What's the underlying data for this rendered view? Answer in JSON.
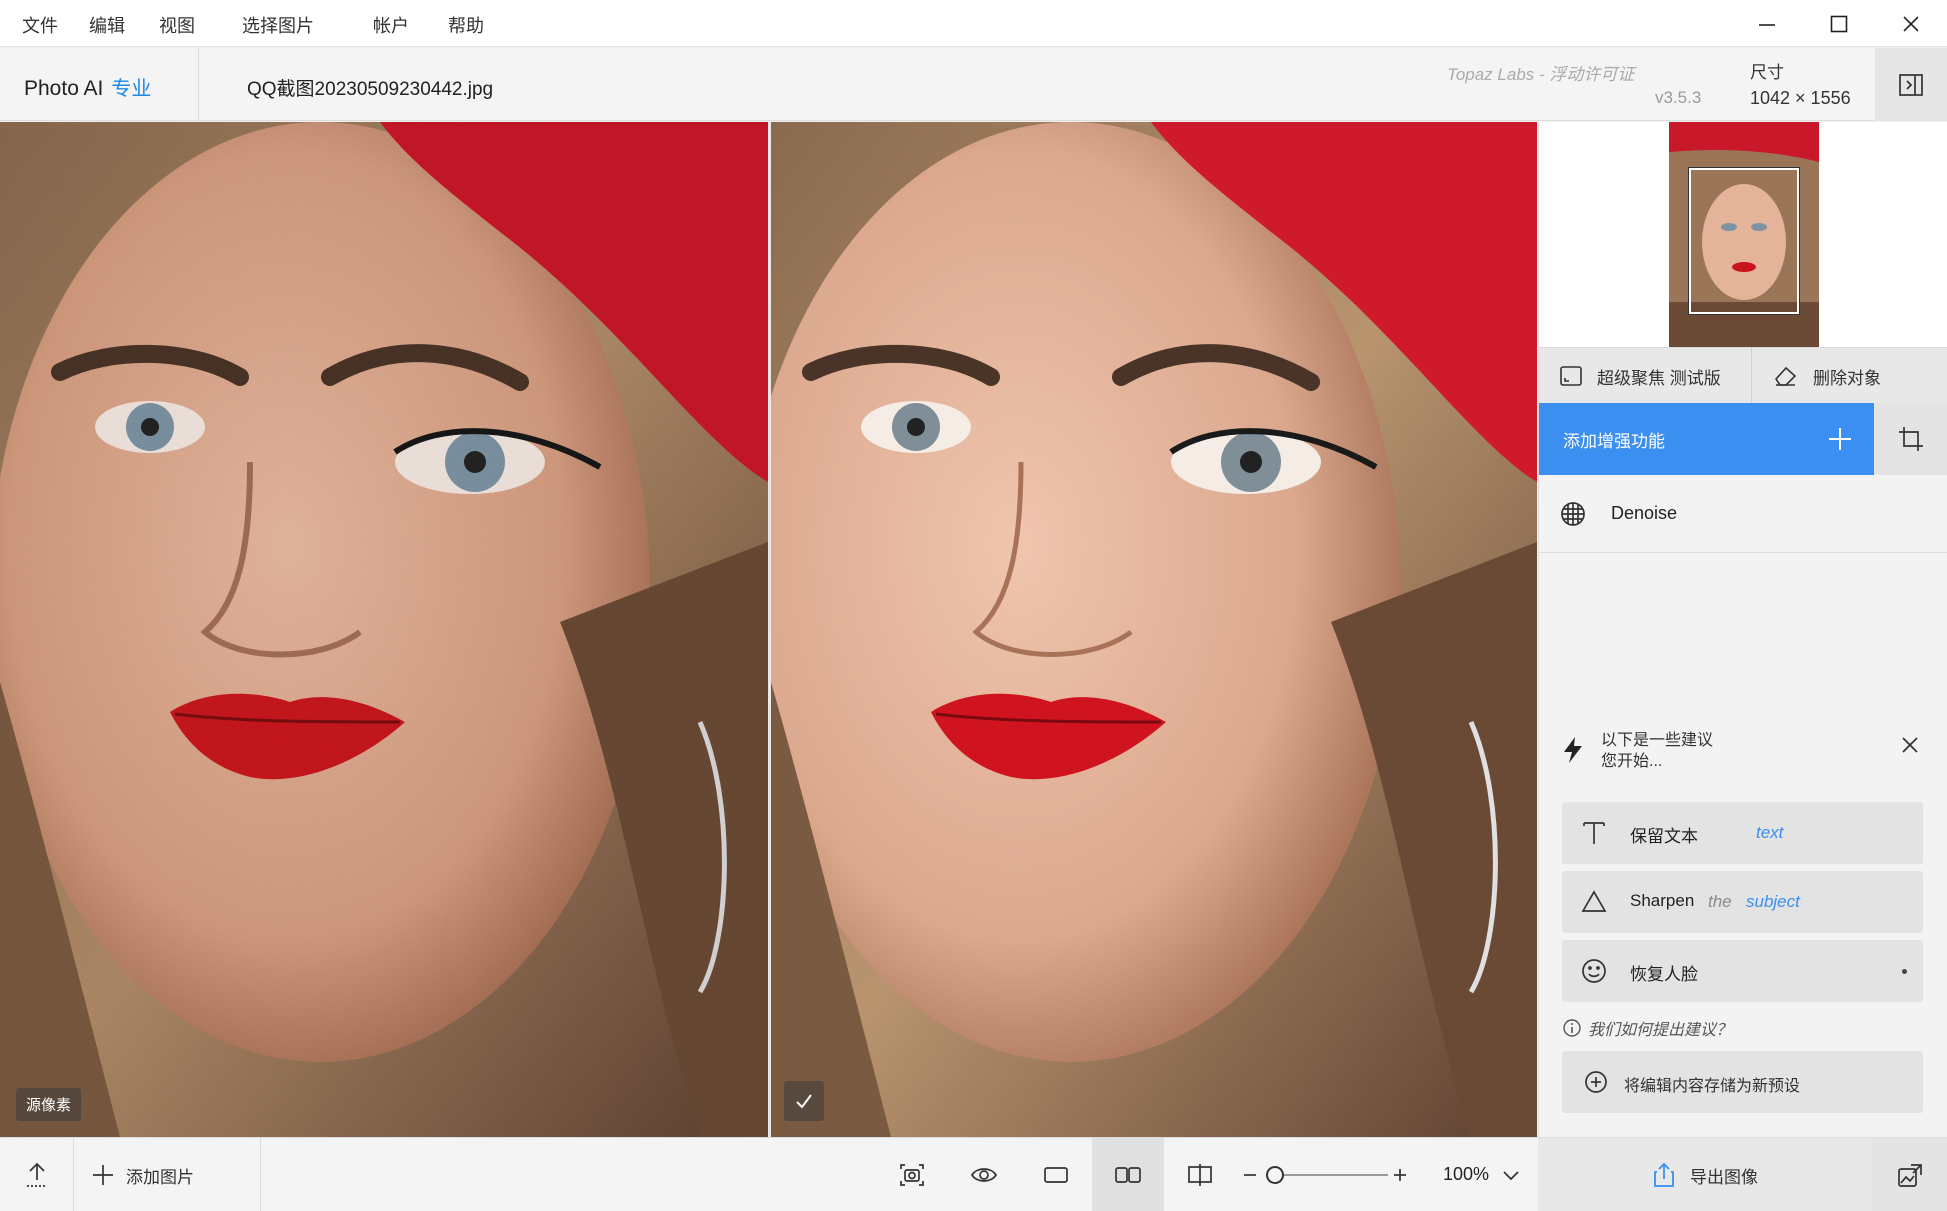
{
  "menu": [
    "文件",
    "编辑",
    "视图",
    "选择图片",
    "帐户",
    "帮助"
  ],
  "window_controls": [
    "minimize-icon",
    "maximize-icon",
    "close-icon"
  ],
  "header": {
    "brand": "Photo AI",
    "brand_tier": "专业",
    "filename": "QQ截图20230509230442.jpg",
    "license": "Topaz Labs - 浮动许可证",
    "version": "v3.5.3",
    "dimensions_label": "尺寸",
    "dimensions_value": "1042 × 1556"
  },
  "viewer": {
    "left_badge": "源像素",
    "right_badge_icon": "check-icon"
  },
  "panel": {
    "tools": [
      {
        "icon": "focus-frame-icon",
        "label": "超级聚焦 测试版"
      },
      {
        "icon": "eraser-icon",
        "label": "删除对象"
      }
    ],
    "add_enhancement": "添加增强功能",
    "enhancements": [
      {
        "icon": "denoise-grid-icon",
        "label": "Denoise"
      }
    ],
    "suggestions_title_line1": "以下是一些建议",
    "suggestions_title_line2": "您开始...",
    "suggestions": [
      {
        "icon": "text-icon",
        "label": "保留文本",
        "modifier": "",
        "target": "text"
      },
      {
        "icon": "triangle-icon",
        "label": "Sharpen",
        "modifier": "the",
        "target": "subject"
      },
      {
        "icon": "smiley-icon",
        "label": "恢复人脸",
        "modifier": "",
        "target": ""
      }
    ],
    "how_suggest": "我们如何提出建议？",
    "save_preset": "将编辑内容存储为新预设"
  },
  "bottom": {
    "add_image": "添加图片",
    "zoom": "100%",
    "export": "导出图像"
  },
  "colors": {
    "accent": "#3b8ff0",
    "brand_pro": "#1e88e5"
  }
}
